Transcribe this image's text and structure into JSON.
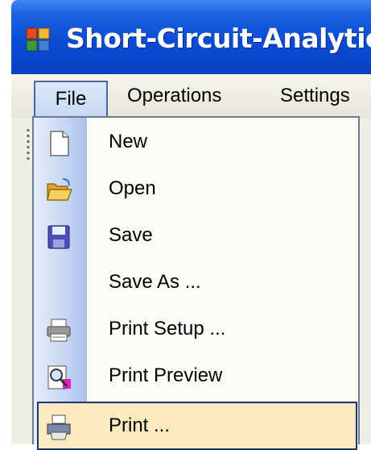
{
  "window": {
    "title": "Short-Circuit-Analytic"
  },
  "menubar": {
    "items": [
      "File",
      "Operations",
      "Settings"
    ]
  },
  "file_menu": {
    "items": [
      {
        "label": "New",
        "icon": "new-document-icon"
      },
      {
        "label": "Open",
        "icon": "open-folder-icon"
      },
      {
        "label": "Save",
        "icon": "save-disk-icon"
      },
      {
        "label": "Save As ...",
        "icon": ""
      },
      {
        "label": "Print Setup ...",
        "icon": "printer-setup-icon"
      },
      {
        "label": "Print Preview",
        "icon": "print-preview-icon"
      },
      {
        "label": "Print ...",
        "icon": "printer-icon",
        "highlighted": true
      }
    ]
  }
}
